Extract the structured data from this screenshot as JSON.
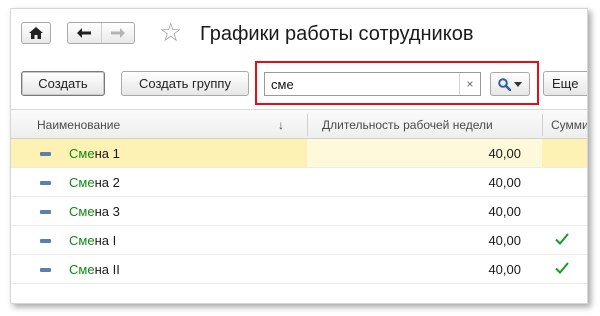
{
  "window": {
    "title": "Графики работы сотрудников"
  },
  "toolbar": {
    "create_label": "Создать",
    "create_group_label": "Создать группу",
    "more_label": "Еще"
  },
  "search": {
    "value": "сме",
    "clear_glyph": "×"
  },
  "table": {
    "columns": {
      "name": "Наименование",
      "sort_glyph": "↓",
      "duration": "Длительность рабочей недели",
      "sum": "Суммир"
    },
    "rows": [
      {
        "match": "Сме",
        "rest": "на 1",
        "value": "40,00",
        "checked": false,
        "selected": true
      },
      {
        "match": "Сме",
        "rest": "на 2",
        "value": "40,00",
        "checked": false,
        "selected": false
      },
      {
        "match": "Сме",
        "rest": "на 3",
        "value": "40,00",
        "checked": false,
        "selected": false
      },
      {
        "match": "Сме",
        "rest": "на I",
        "value": "40,00",
        "checked": true,
        "selected": false
      },
      {
        "match": "Сме",
        "rest": "на II",
        "value": "40,00",
        "checked": true,
        "selected": false
      }
    ]
  },
  "colors": {
    "highlight_red": "#e0101a",
    "match_green": "#0f8a16",
    "selection_yellow": "#fdf1b3",
    "check_green": "#1a9a2a"
  }
}
